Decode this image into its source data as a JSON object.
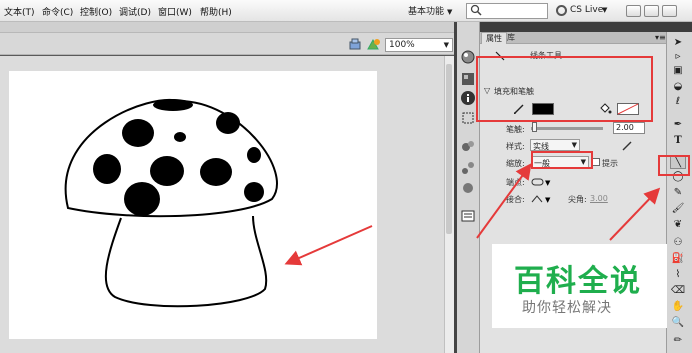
{
  "menubar": {
    "items": [
      "文本(T)",
      "命令(C)",
      "控制(O)",
      "调试(D)",
      "窗口(W)",
      "帮助(H)"
    ],
    "workspace": "基本功能",
    "search_value": "",
    "cs_live": "CS Live"
  },
  "stage": {
    "zoom": "100%"
  },
  "panel": {
    "tabs": [
      "属性",
      "库"
    ],
    "tool_name": "线条工具",
    "section": "填充和笔触",
    "stroke_label": "笔触:",
    "stroke_value": "2.00",
    "style_label": "样式:",
    "style_value": "实线",
    "scale_label": "缩放:",
    "scale_value": "一般",
    "hint_label": "提示",
    "cap_label": "端点:",
    "join_label": "接合:",
    "miter_label": "尖角:",
    "miter_value": "3.00"
  },
  "watermark": {
    "title": "百科全说",
    "subtitle": "助你轻松解决"
  },
  "colors": {
    "stroke_color": "#000000",
    "fill_color": "#ffffff",
    "annotation_red": "#e53a3a",
    "watermark_green": "#1fae4d"
  },
  "icons": [
    "search-icon",
    "cs-live-icon",
    "minimize-icon",
    "restore-icon",
    "close-icon",
    "pencil-icon",
    "paint-bucket-icon",
    "line-tool-icon",
    "selection-tool-icon",
    "text-tool-icon",
    "eraser-icon",
    "hand-tool-icon",
    "zoom-tool-icon"
  ]
}
